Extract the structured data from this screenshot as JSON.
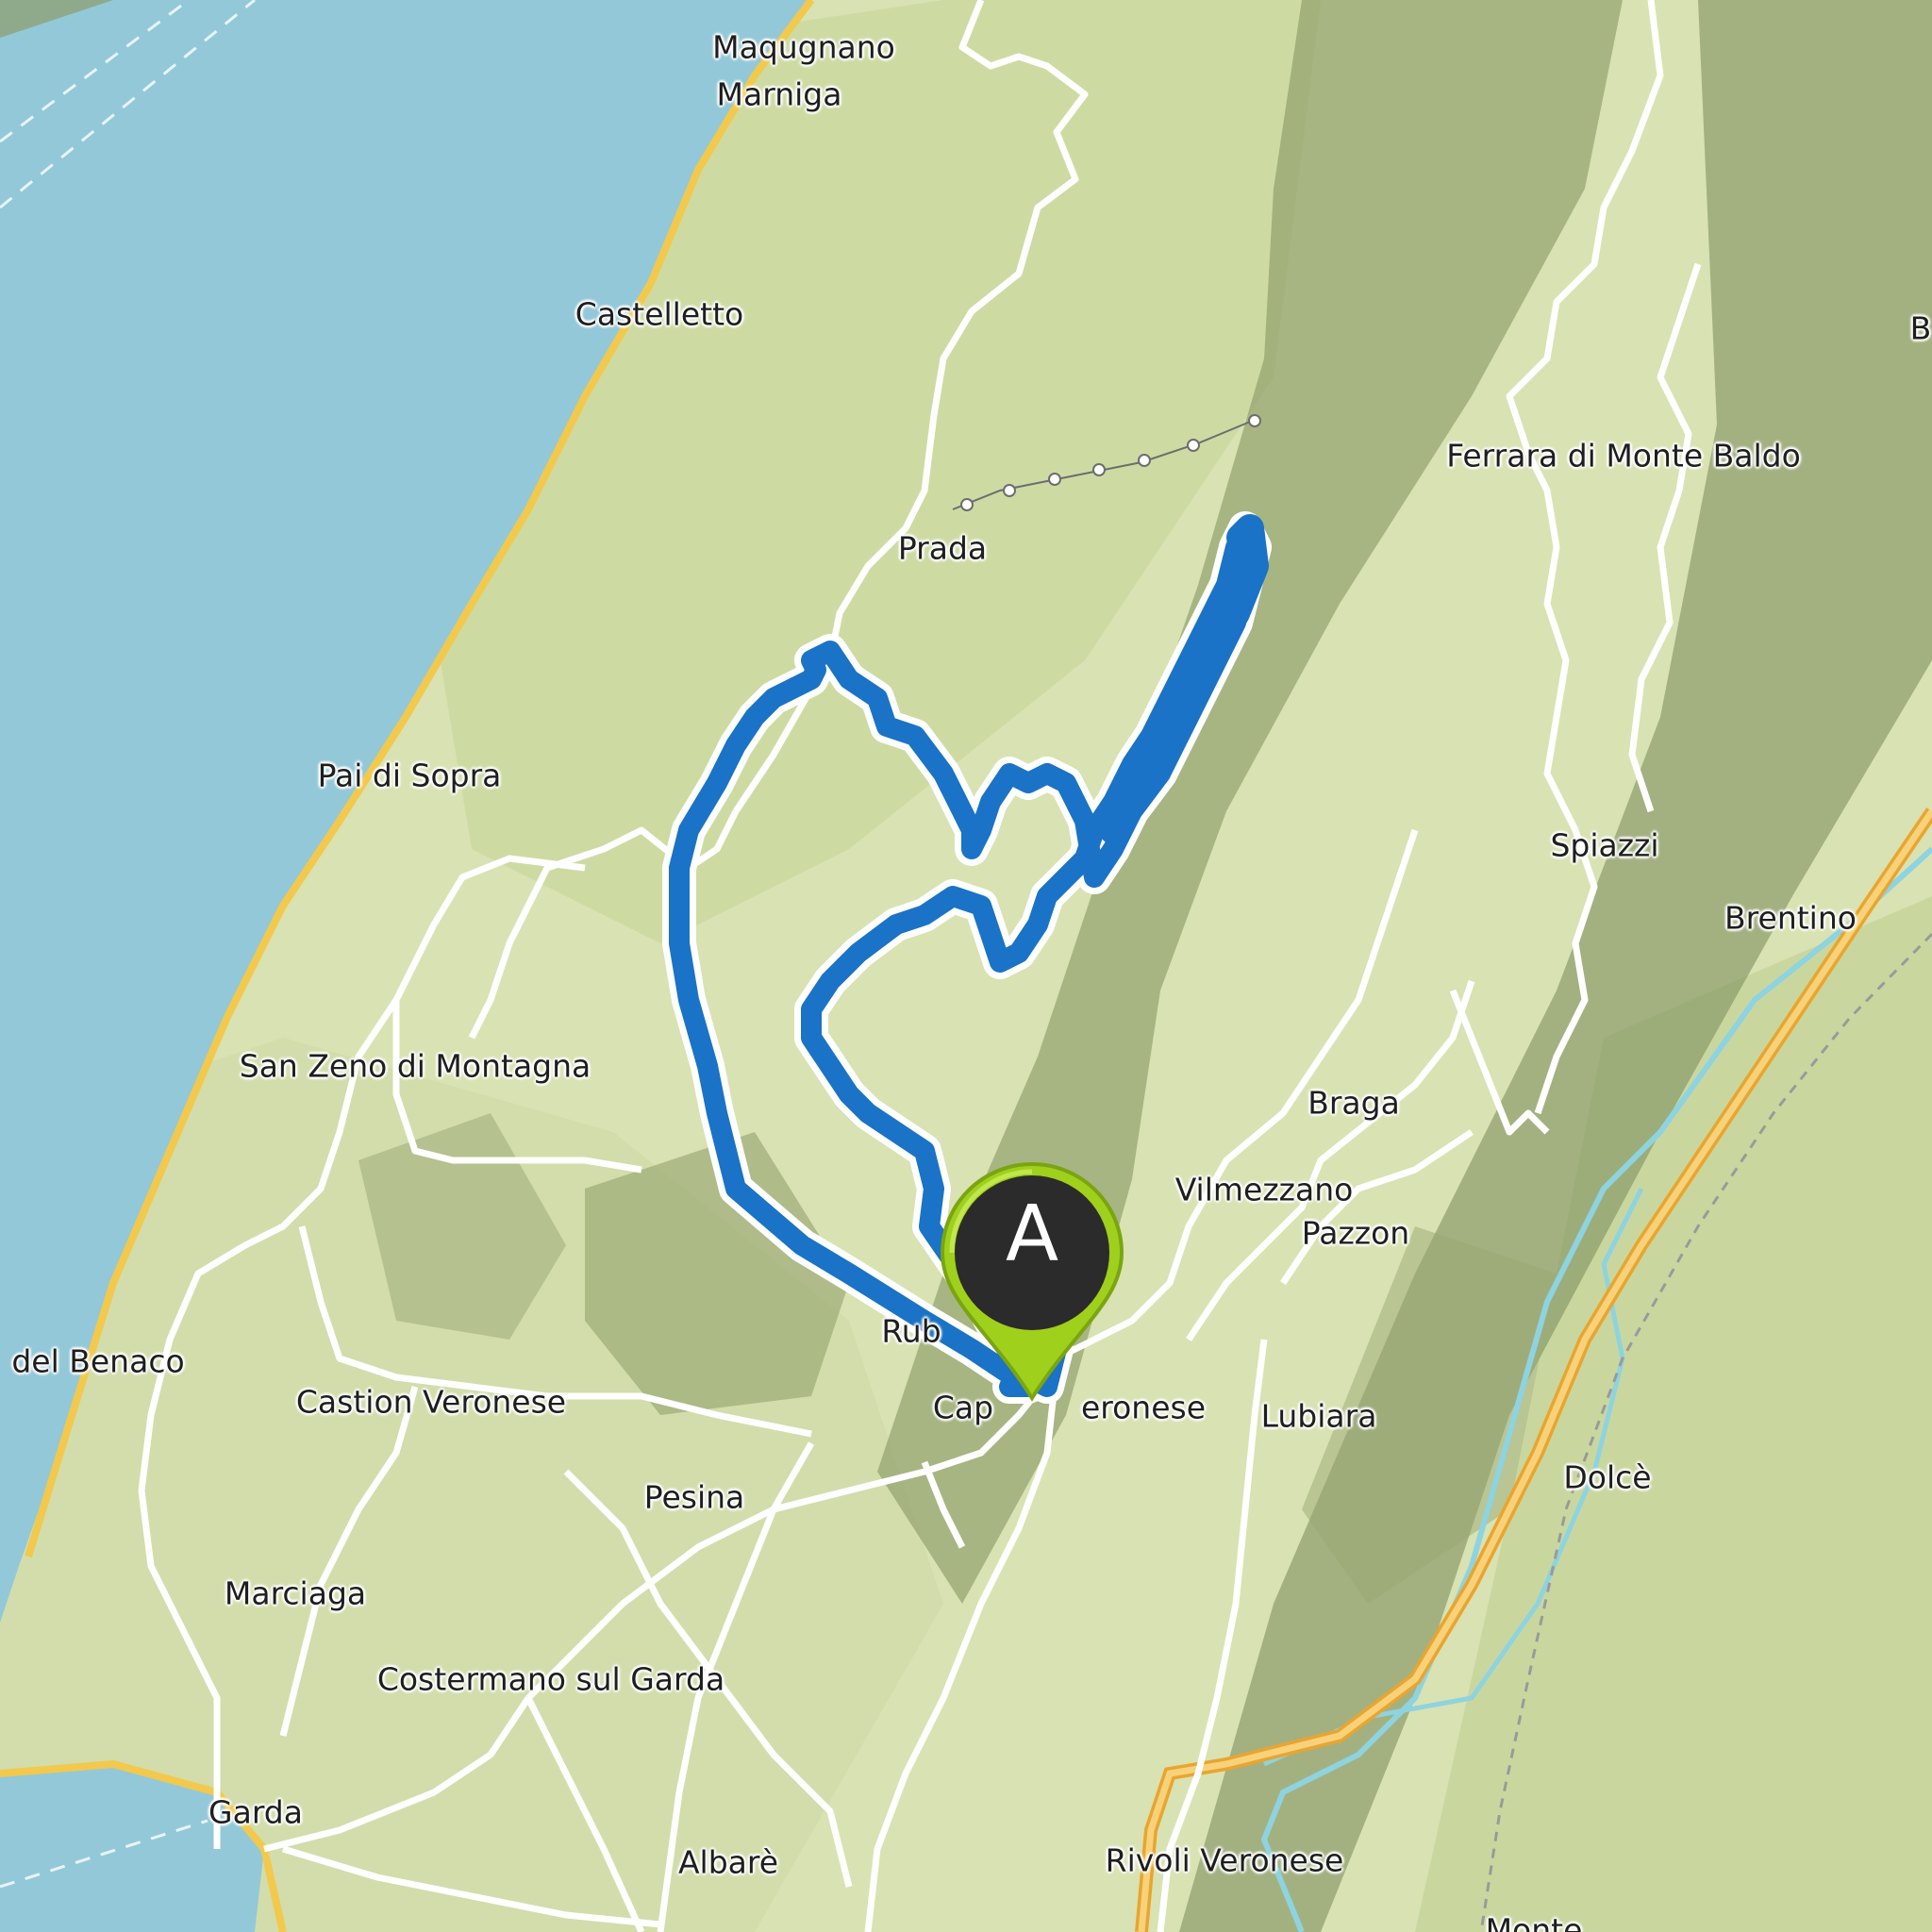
{
  "map": {
    "colors": {
      "water": "#93c8d9",
      "land": "#d9e2b2",
      "forest": "#c7d8a0",
      "mountain_shade": "#8c9c68",
      "road_major": "#f2c94c",
      "road_minor": "#ffffff",
      "river": "#8ed3e0",
      "route": "#1a73c6",
      "marker_fill": "#9fd01c",
      "marker_inner": "#2b2b2b"
    },
    "labels": {
      "maqugnano": "Maqugnano",
      "marniga": "Marniga",
      "castelletto": "Castelletto",
      "ferrara": "Ferrara di Monte Baldo",
      "prada": "Prada",
      "pai_di_sopra": "Pai di Sopra",
      "spiazzi": "Spiazzi",
      "brentino": "Brentino",
      "san_zeno": "San Zeno di Montagna",
      "braga": "Braga",
      "vilmezzano": "Vilmezzano",
      "pazzon": "Pazzon",
      "rubiana": "Rub",
      "del_benaco": "del Benaco",
      "castion": "Castion Veronese",
      "caprino": "Cap",
      "caprino_rest": "eronese",
      "lubiara": "Lubiara",
      "pesina": "Pesina",
      "dolce": "Dolcè",
      "marciaga": "Marciaga",
      "costermano": "Costermano sul Garda",
      "garda": "Garda",
      "albare": "Albarè",
      "rivoli": "Rivoli Veronese",
      "monte": "Monte",
      "edge_b": "B"
    },
    "marker": {
      "letter": "A",
      "icon": "start-pin-icon"
    }
  }
}
